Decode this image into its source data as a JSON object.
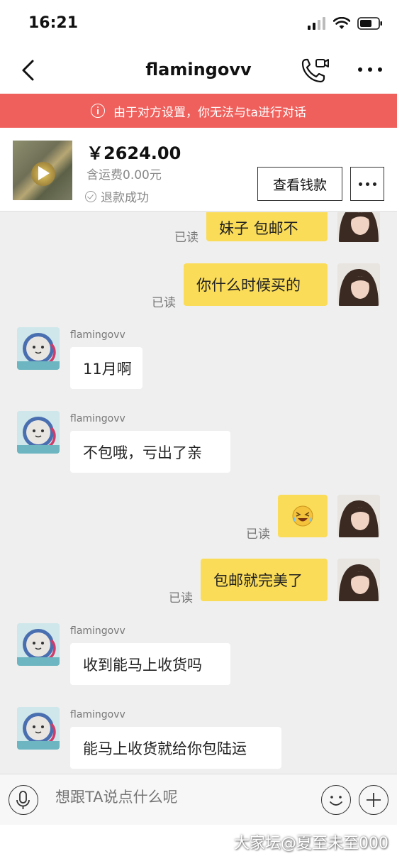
{
  "status_bar": {
    "time": "16:21"
  },
  "nav": {
    "title": "flamingovv",
    "icons": [
      "back-icon",
      "video-call-icon",
      "more-icon"
    ]
  },
  "banner": {
    "text": "由于对方设置，你无法与ta进行对话",
    "color": "#ef605c"
  },
  "product": {
    "price": "￥2624.00",
    "shipping": "含运费0.00元",
    "status": "退款成功",
    "view_button": "查看钱款"
  },
  "chat": {
    "read_label": "已读",
    "partner_name": "flamingovv",
    "messages": [
      {
        "from": "me",
        "text": "妹子 包邮不",
        "read": "已读"
      },
      {
        "from": "me",
        "text": "你什么时候买的",
        "read": "已读"
      },
      {
        "from": "them",
        "sender": "flamingovv",
        "text": "11月啊"
      },
      {
        "from": "them",
        "sender": "flamingovv",
        "text": "不包哦，亏出了亲"
      },
      {
        "from": "me",
        "text": "😂",
        "read": "已读"
      },
      {
        "from": "me",
        "text": "包邮就完美了",
        "read": "已读"
      },
      {
        "from": "them",
        "sender": "flamingovv",
        "text": "收到能马上收货吗"
      },
      {
        "from": "them",
        "sender": "flamingovv",
        "text": "能马上收货就给你包陆运"
      }
    ],
    "me_bubble_color": "#fadc58"
  },
  "input": {
    "placeholder": "想跟TA说点什么呢"
  },
  "watermark": "大家坛@夏至未至000"
}
